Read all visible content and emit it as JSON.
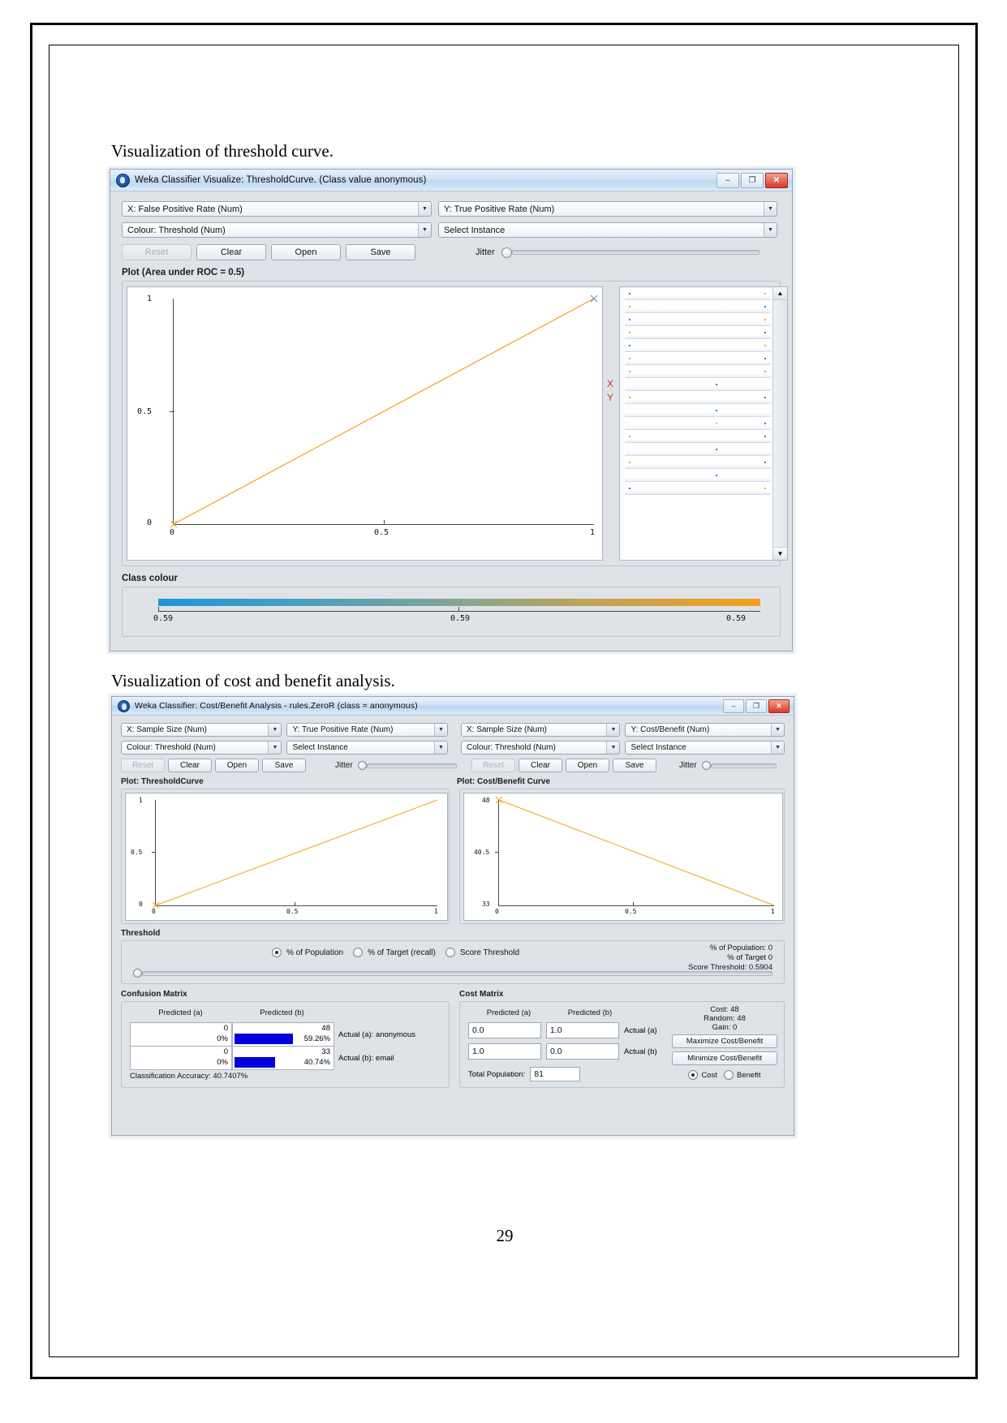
{
  "document": {
    "caption_threshold": "Visualization of threshold curve.",
    "caption_costbenefit": "Visualization of cost and benefit analysis.",
    "page_number": "29"
  },
  "threshold_window": {
    "title": "Weka Classifier Visualize: ThresholdCurve. (Class value anonymous)",
    "icon": "weka-bird-icon",
    "window_buttons": {
      "minimize": "–",
      "maximize": "❐",
      "close": "✕"
    },
    "selectors": {
      "x_axis": "X: False Positive Rate (Num)",
      "y_axis": "Y: True Positive Rate (Num)",
      "colour": "Colour: Threshold (Num)",
      "select_instance": "Select Instance"
    },
    "buttons": {
      "reset": "Reset",
      "clear": "Clear",
      "open": "Open",
      "save": "Save"
    },
    "jitter_label": "Jitter",
    "plot_label": "Plot (Area under ROC = 0.5)",
    "axis_markers": {
      "x": "X",
      "y": "Y"
    },
    "class_colour": {
      "label": "Class colour",
      "ticks": [
        "0.59",
        "0.59",
        "0.59"
      ],
      "gradient_from": "#1f96d8",
      "gradient_to": "#f4a11e"
    }
  },
  "costbenefit_window": {
    "title": "Weka Classifier: Cost/Benefit Analysis - rules.ZeroR  (class = anonymous)",
    "icon": "weka-bird-icon",
    "window_buttons": {
      "minimize": "–",
      "maximize": "❐",
      "close": "✕"
    },
    "left_panel": {
      "x_axis": "X: Sample Size (Num)",
      "y_axis": "Y: True Positive Rate (Num)",
      "colour": "Colour: Threshold (Num)",
      "select_instance": "Select Instance",
      "buttons": {
        "reset": "Reset",
        "clear": "Clear",
        "open": "Open",
        "save": "Save"
      },
      "jitter_label": "Jitter",
      "plot_label": "Plot: ThresholdCurve"
    },
    "right_panel": {
      "x_axis": "X: Sample Size (Num)",
      "y_axis": "Y: Cost/Benefit (Num)",
      "colour": "Colour: Threshold (Num)",
      "select_instance": "Select Instance",
      "buttons": {
        "reset": "Reset",
        "clear": "Clear",
        "open": "Open",
        "save": "Save"
      },
      "jitter_label": "Jitter",
      "plot_label": "Plot: Cost/Benefit Curve"
    },
    "threshold": {
      "label": "Threshold",
      "options": [
        "% of Population",
        "% of Target (recall)",
        "Score Threshold"
      ],
      "selected": "% of Population",
      "readout": {
        "pct_population": "% of Population: 0",
        "pct_target": "% of Target 0",
        "score_threshold": "Score Threshold: 0.5904"
      }
    },
    "confusion_matrix": {
      "label": "Confusion Matrix",
      "col_headers": [
        "Predicted (a)",
        "Predicted (b)"
      ],
      "rows": [
        {
          "a_count": "0",
          "a_pct": "0%",
          "b_count": "48",
          "b_pct": "59.26%",
          "row_label": "Actual (a): anonymous",
          "bar_pct": 59.26
        },
        {
          "a_count": "0",
          "a_pct": "0%",
          "b_count": "33",
          "b_pct": "40.74%",
          "row_label": "Actual (b): email",
          "bar_pct": 40.74
        }
      ],
      "accuracy": "Classification Accuracy:  40.7407%",
      "bar_color": "#0000dd"
    },
    "cost_matrix": {
      "label": "Cost Matrix",
      "col_headers": [
        "Predicted (a)",
        "Predicted (b)"
      ],
      "rows": [
        {
          "a": "0.0",
          "b": "1.0",
          "row_label": "Actual (a)"
        },
        {
          "a": "1.0",
          "b": "0.0",
          "row_label": "Actual (b)"
        }
      ],
      "total_population_label": "Total Population:",
      "total_population_value": "81",
      "stats": {
        "cost": "Cost: 48",
        "random": "Random: 48",
        "gain": "Gain: 0"
      },
      "buttons": {
        "maximize": "Maximize Cost/Benefit",
        "minimize": "Minimize Cost/Benefit"
      },
      "mode_options": [
        "Cost",
        "Benefit"
      ],
      "mode_selected": "Cost"
    }
  },
  "chart_data": [
    {
      "type": "line",
      "title": "Plot (Area under ROC = 0.5)",
      "xlabel": "False Positive Rate",
      "ylabel": "True Positive Rate",
      "x": [
        0,
        1
      ],
      "values": [
        0,
        1
      ],
      "xticks": [
        "0",
        "0.5",
        "1"
      ],
      "yticks": [
        "0",
        "0.5",
        "1"
      ],
      "xlim": [
        0,
        1
      ],
      "ylim": [
        0,
        1
      ],
      "grid": false,
      "series_color": "#f0a31e"
    },
    {
      "type": "line",
      "title": "Plot: ThresholdCurve",
      "xlabel": "Sample Size",
      "ylabel": "True Positive Rate",
      "x": [
        0,
        1
      ],
      "values": [
        0,
        1
      ],
      "xticks": [
        "0",
        "0.5",
        "1"
      ],
      "yticks": [
        "0",
        "0.5",
        "1"
      ],
      "xlim": [
        0,
        1
      ],
      "ylim": [
        0,
        1
      ],
      "grid": false,
      "series_color": "#f0a31e"
    },
    {
      "type": "line",
      "title": "Plot: Cost/Benefit Curve",
      "xlabel": "Sample Size",
      "ylabel": "Cost/Benefit",
      "x": [
        0,
        1
      ],
      "values": [
        48,
        33
      ],
      "xticks": [
        "0",
        "0.5",
        "1"
      ],
      "yticks": [
        "33",
        "40.5",
        "48"
      ],
      "xlim": [
        0,
        1
      ],
      "ylim": [
        33,
        48
      ],
      "grid": false,
      "series_color": "#f0a31e"
    }
  ]
}
